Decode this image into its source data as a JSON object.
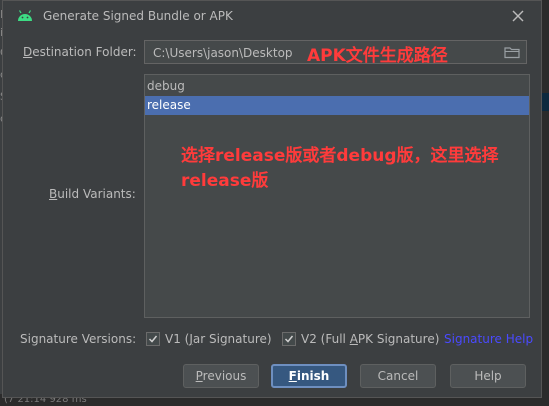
{
  "window": {
    "title": "Generate Signed Bundle or APK",
    "close_icon": "close-icon"
  },
  "background": {
    "frag1": "Pl",
    "frag2": "ie",
    "frag3": "G",
    "frag4": "c",
    "frag5": "Sc",
    "frag6": "c",
    "status": "(7 21:14      928 ms"
  },
  "destination": {
    "label_prefix": "D",
    "label_rest": "estination Folder:",
    "value": "C:\\Users\\jason\\Desktop",
    "browse_icon": "folder-icon"
  },
  "annotation_path": "APK文件生成路径",
  "build_variants": {
    "label_prefix": "B",
    "label_rest": "uild Variants:",
    "items": [
      {
        "label": "debug",
        "selected": false
      },
      {
        "label": "release",
        "selected": true
      }
    ]
  },
  "annotation_variant_line1": "选择release版或者debug版，这里选择",
  "annotation_variant_line2": "release版",
  "signature": {
    "label": "Signature Versions:",
    "v1_label_pre": "V1 (",
    "v1_label_u": "J",
    "v1_label_post": "ar Signature)",
    "v1_checked": true,
    "v2_label_pre": "V2 (Full ",
    "v2_label_u": "A",
    "v2_label_post": "PK Signature)",
    "v2_checked": true,
    "help_link": "Signature Help"
  },
  "buttons": {
    "previous_u": "P",
    "previous_rest": "revious",
    "finish_u": "F",
    "finish_rest": "inish",
    "cancel": "Cancel",
    "help": "Help"
  },
  "colors": {
    "selection": "#4b6eaf",
    "annotation": "#ff3b3b",
    "link": "#4a4aff",
    "android_green": "#3ddc84"
  }
}
